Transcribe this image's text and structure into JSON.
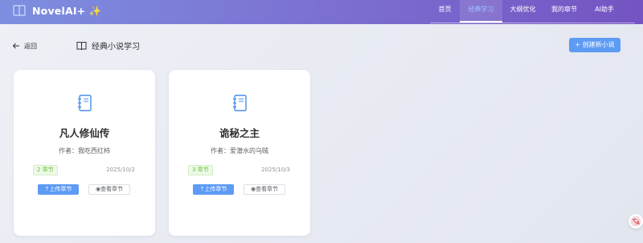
{
  "app": {
    "title": "NovelAI+ ✨"
  },
  "nav": {
    "items": [
      {
        "label": "首页"
      },
      {
        "label": "经典学习"
      },
      {
        "label": "大纲优化"
      },
      {
        "label": "我的章节"
      },
      {
        "label": "AI助手"
      }
    ],
    "active_index": 1
  },
  "toolbar": {
    "back_label": "返回",
    "page_title": "经典小说学习",
    "create_label": "+ 创建新小说"
  },
  "novels": [
    {
      "title": "凡人修仙传",
      "author": "作者：我吃西红柿",
      "chapters": "2 章节",
      "date": "2025/10/2",
      "upload_label": "上传章节",
      "view_label": "查看章节"
    },
    {
      "title": "诡秘之主",
      "author": "作者：爱潜水的乌贼",
      "chapters": "3 章节",
      "date": "2025/10/3",
      "upload_label": "上传章节",
      "view_label": "查看章节"
    }
  ],
  "colors": {
    "primary": "#5d9bf5",
    "header_start": "#7d8fe0",
    "header_end": "#7454c2",
    "badge_green": "#67c23a"
  },
  "icons": {
    "logo": "book-open-icon",
    "back": "arrow-left-icon",
    "heading": "book-icon",
    "card": "notebook-icon",
    "upload": "upload-icon",
    "view": "eye-icon",
    "floating": "translate-icon"
  }
}
